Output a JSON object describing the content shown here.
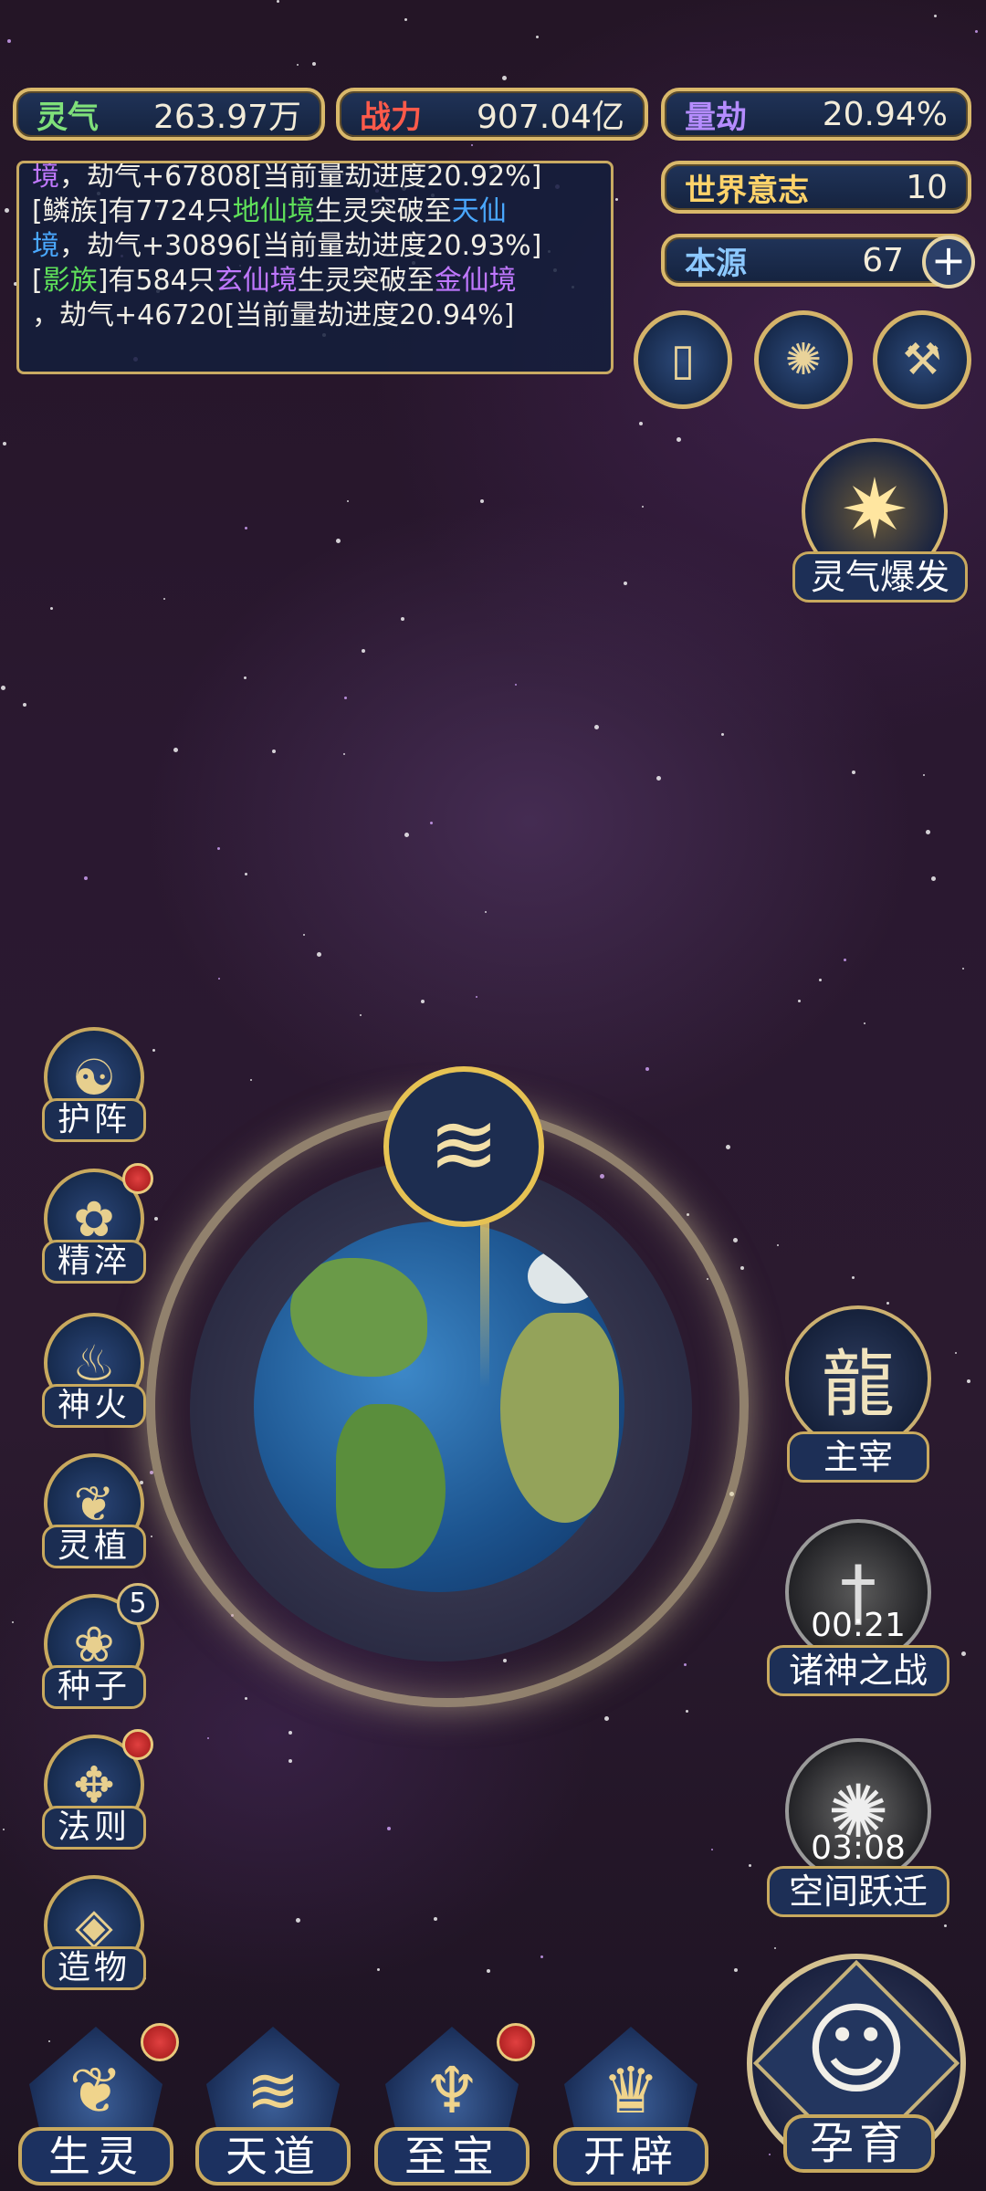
{
  "stats": {
    "lingqi": {
      "name": "灵气",
      "value": "263.97万",
      "color": "#7fe07a"
    },
    "zhanli": {
      "name": "战力",
      "value": "907.04亿",
      "color": "#ff5a4a"
    },
    "liangjie": {
      "name": "量劫",
      "value": "20.94%",
      "color": "#b58cff"
    },
    "shijie": {
      "name": "世界意志",
      "value": "10",
      "color": "#ffd36a"
    },
    "benyuan": {
      "name": "本源",
      "value": "67",
      "color": "#8cc8ff"
    }
  },
  "log": {
    "line1": {
      "a": "境",
      "b": "，劫气+67808[当前量劫进度20.92%]"
    },
    "line2": {
      "a": "[鳞族]有7724只",
      "b": "地仙境",
      "c": "生灵突破至",
      "d": "天仙"
    },
    "line3": {
      "a": "境",
      "b": "，劫气+30896[当前量劫进度20.93%]"
    },
    "line4": {
      "a": "[",
      "b": "影族",
      "c": "]有584只",
      "d": "玄仙境",
      "e": "生灵突破至",
      "f": "金仙境"
    },
    "line5": {
      "a": "，劫气+46720[当前量劫进度20.94%]"
    }
  },
  "top_buttons": {
    "card_icon": "card-icon",
    "swirl_icon": "swirl-icon",
    "axe_icon": "axe-icon"
  },
  "burst": {
    "label": "灵气爆发",
    "icon": "starburst-icon"
  },
  "left_menu": [
    {
      "label": "护阵",
      "icon": "yin-yang-icon",
      "dot": false
    },
    {
      "label": "精淬",
      "icon": "lotus-icon",
      "dot": true
    },
    {
      "label": "神火",
      "icon": "flame-icon",
      "dot": false
    },
    {
      "label": "灵植",
      "icon": "plant-icon",
      "dot": false
    },
    {
      "label": "种子",
      "icon": "seed-icon",
      "badge": "5"
    },
    {
      "label": "法则",
      "icon": "rune-icon",
      "dot": true
    },
    {
      "label": "造物",
      "icon": "diamond-icon",
      "dot": false
    }
  ],
  "right_menu": {
    "zhuzai": {
      "label": "主宰",
      "icon": "dragon-icon"
    },
    "zhushen": {
      "label": "诸神之战",
      "timer": "00:21",
      "icon": "sword-icon"
    },
    "kongjian": {
      "label": "空间跃迁",
      "timer": "03:08",
      "icon": "vortex-icon"
    }
  },
  "bottom_nav": [
    {
      "label": "生灵",
      "icon": "phoenix-icon",
      "dot": true
    },
    {
      "label": "天道",
      "icon": "wave-icon",
      "dot": false
    },
    {
      "label": "至宝",
      "icon": "gourd-icon",
      "dot": true
    },
    {
      "label": "开辟",
      "icon": "crest-icon",
      "dot": false
    }
  ],
  "yunyu": {
    "label": "孕育",
    "icon": "figure-icon"
  },
  "globe": {
    "marker_icon": "wave-crest-icon"
  }
}
